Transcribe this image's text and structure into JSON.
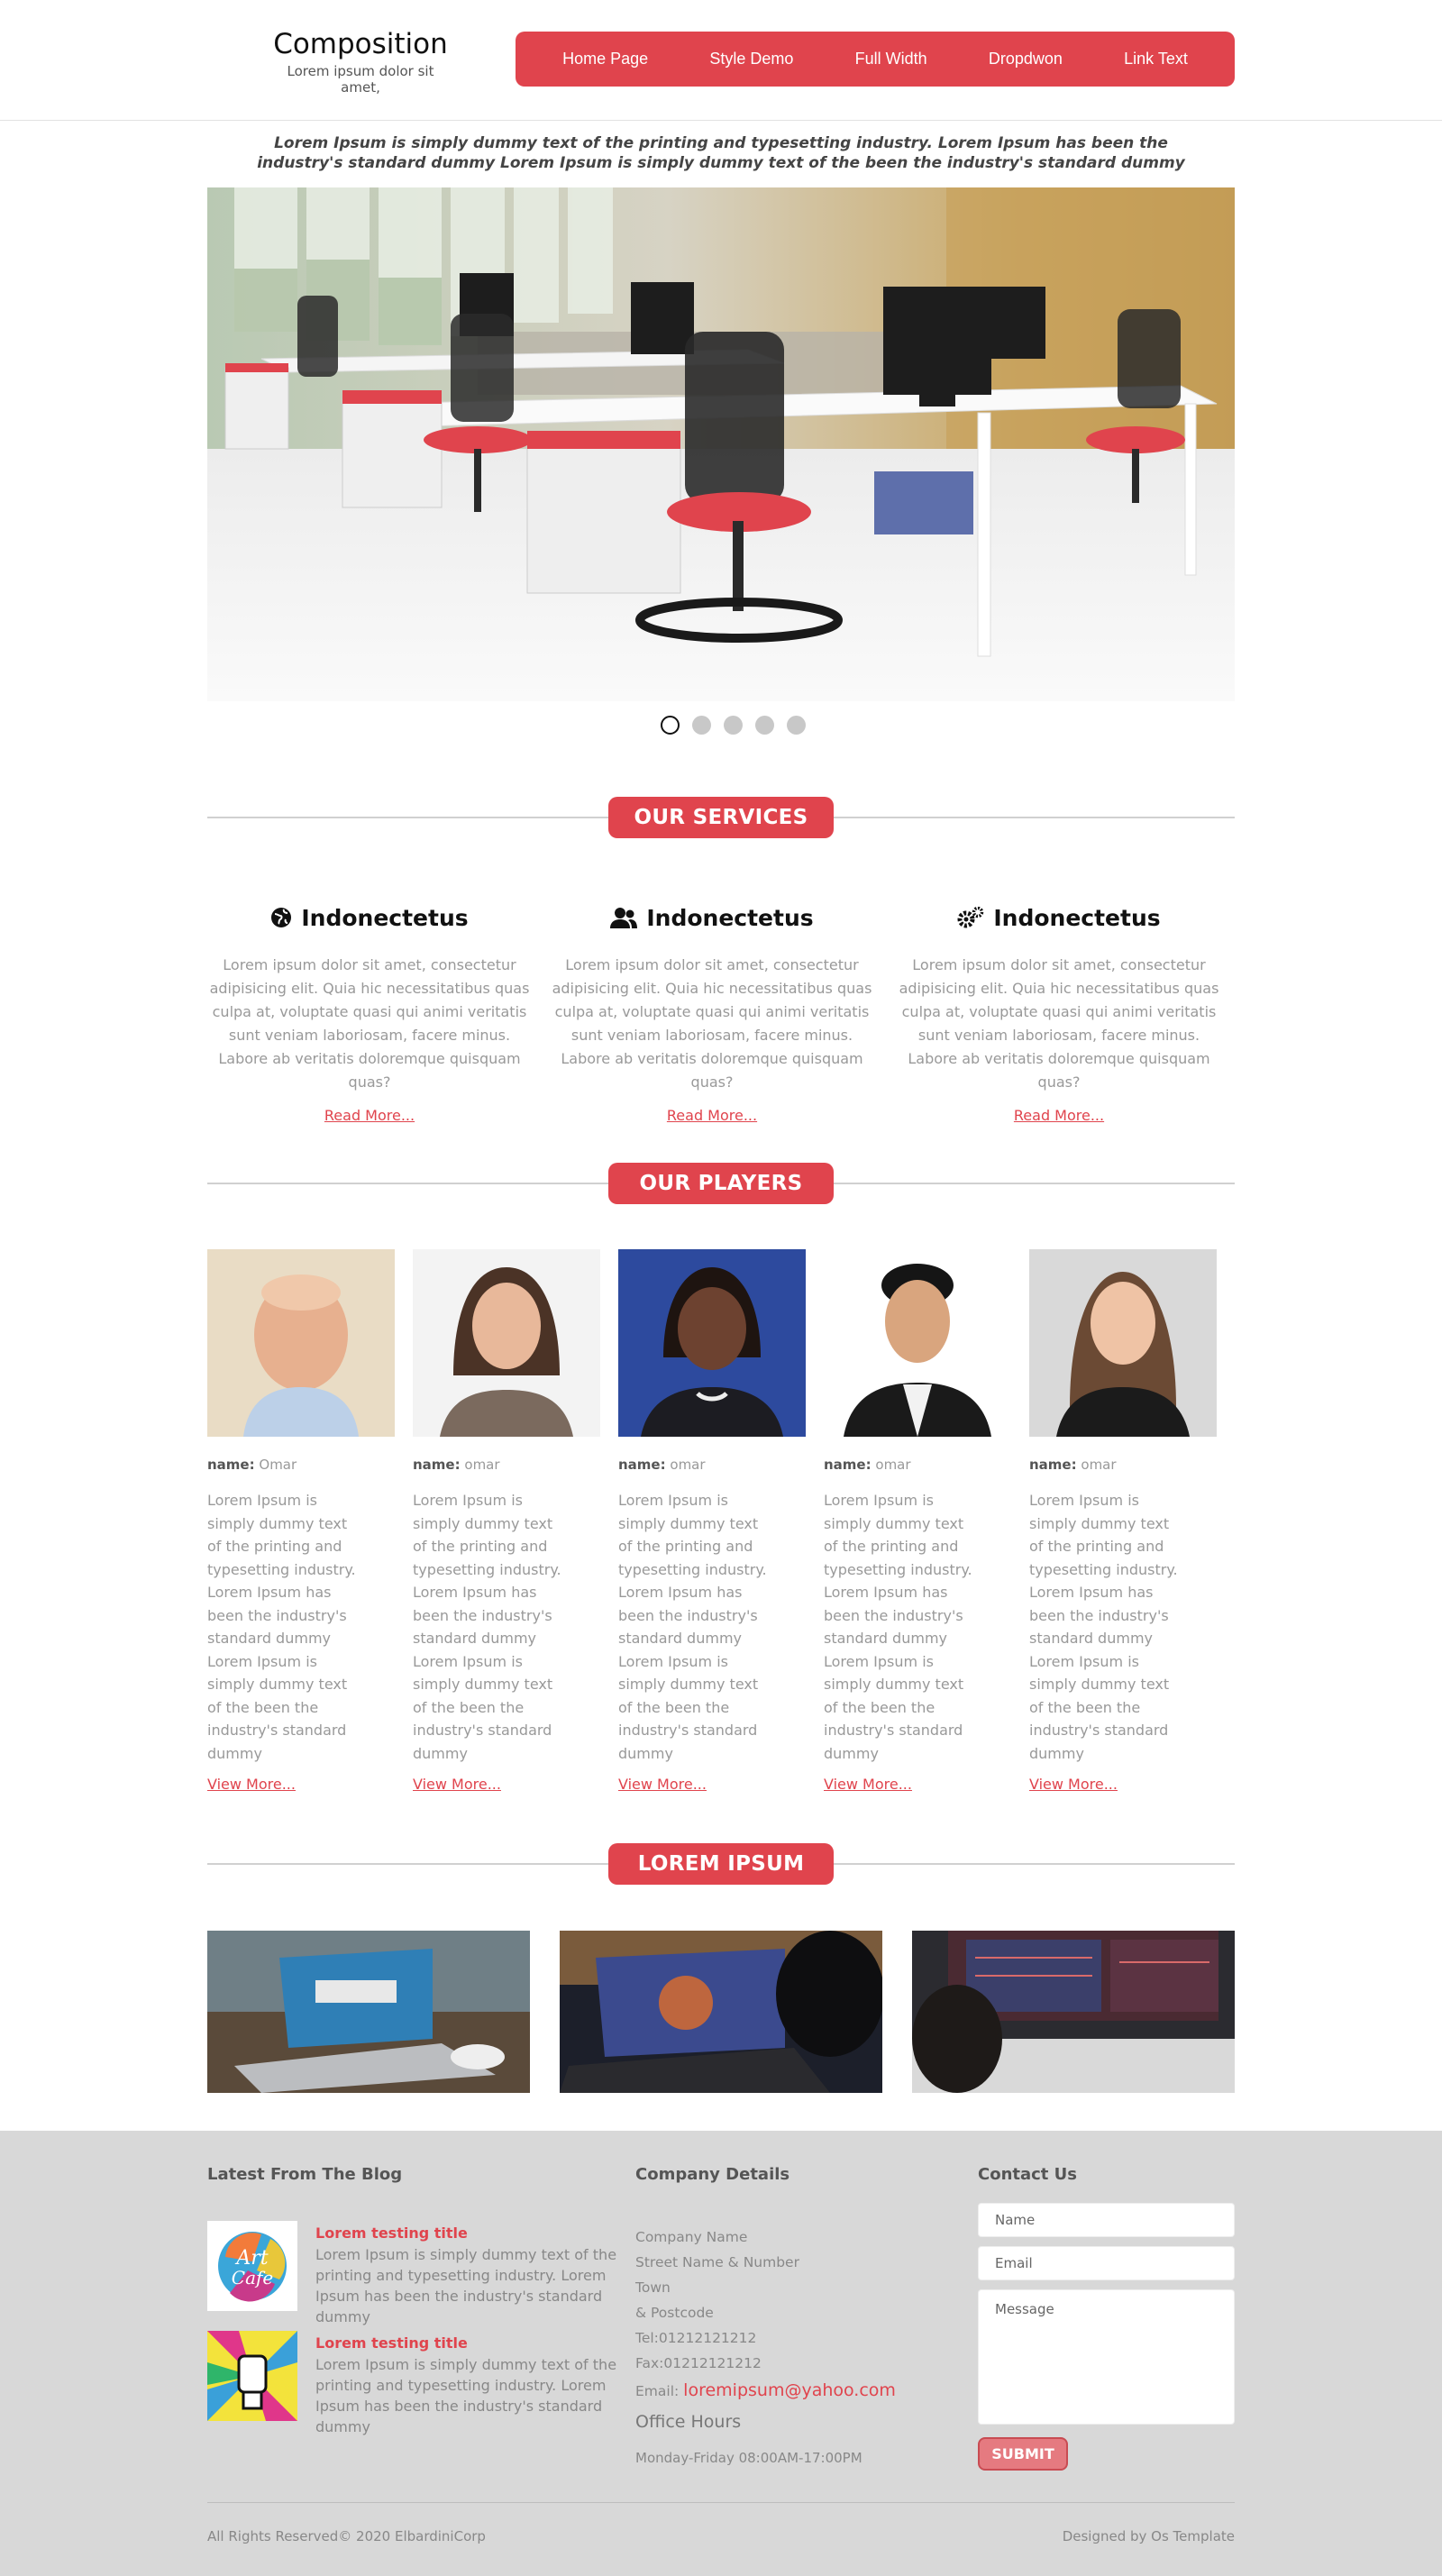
{
  "header": {
    "brand_title": "Composition",
    "brand_subtitle": "Lorem ipsum dolor sit amet,",
    "nav": [
      "Home Page",
      "Style Demo",
      "Full Width",
      "Dropdwon",
      "Link Text"
    ]
  },
  "intro": "Lorem Ipsum is simply dummy text of the printing and typesetting industry. Lorem Ipsum has been the industry's standard dummy Lorem Ipsum is simply dummy text of the been the industry's standard dummy",
  "slider": {
    "slide_count": 5,
    "active_index": 1
  },
  "services": {
    "heading": "OUR SERVICES",
    "items": [
      {
        "icon": "globe-icon",
        "title": "Indonectetus",
        "text": "Lorem ipsum dolor sit amet, consectetur adipisicing elit. Quia hic necessitatibus quas culpa at, voluptate quasi qui animi veritatis sunt veniam laboriosam, facere minus. Labore ab veritatis doloremque quisquam quas?",
        "link": "Read More..."
      },
      {
        "icon": "users-icon",
        "title": "Indonectetus",
        "text": "Lorem ipsum dolor sit amet, consectetur adipisicing elit. Quia hic necessitatibus quas culpa at, voluptate quasi qui animi veritatis sunt veniam laboriosam, facere minus. Labore ab veritatis doloremque quisquam quas?",
        "link": "Read More..."
      },
      {
        "icon": "gears-icon",
        "title": "Indonectetus",
        "text": "Lorem ipsum dolor sit amet, consectetur adipisicing elit. Quia hic necessitatibus quas culpa at, voluptate quasi qui animi veritatis sunt veniam laboriosam, facere minus. Labore ab veritatis doloremque quisquam quas?",
        "link": "Read More..."
      }
    ]
  },
  "players": {
    "heading": "OUR PLAYERS",
    "items": [
      {
        "label": "name:",
        "name": "Omar",
        "bio": "Lorem Ipsum is simply dummy text of the printing and typesetting industry. Lorem Ipsum has been the industry's standard dummy Lorem Ipsum is simply dummy text of the been the industry's standard dummy",
        "link": "View More..."
      },
      {
        "label": "name:",
        "name": "omar",
        "bio": "Lorem Ipsum is simply dummy text of the printing and typesetting industry. Lorem Ipsum has been the industry's standard dummy Lorem Ipsum is simply dummy text of the been the industry's standard dummy",
        "link": "View More..."
      },
      {
        "label": "name:",
        "name": "omar",
        "bio": "Lorem Ipsum is simply dummy text of the printing and typesetting industry. Lorem Ipsum has been the industry's standard dummy Lorem Ipsum is simply dummy text of the been the industry's standard dummy",
        "link": "View More..."
      },
      {
        "label": "name:",
        "name": "omar",
        "bio": "Lorem Ipsum is simply dummy text of the printing and typesetting industry. Lorem Ipsum has been the industry's standard dummy Lorem Ipsum is simply dummy text of the been the industry's standard dummy",
        "link": "View More..."
      },
      {
        "label": "name:",
        "name": "omar",
        "bio": "Lorem Ipsum is simply dummy text of the printing and typesetting industry. Lorem Ipsum has been the industry's standard dummy Lorem Ipsum is simply dummy text of the been the industry's standard dummy",
        "link": "View More..."
      }
    ]
  },
  "gallery": {
    "heading": "LOREM IPSUM"
  },
  "footer": {
    "blog": {
      "heading": "Latest From The Blog",
      "posts": [
        {
          "title": "Lorem testing title",
          "text": "Lorem Ipsum is simply dummy text of the printing and typesetting industry. Lorem Ipsum has been the industry's standard dummy"
        },
        {
          "title": "Lorem testing title",
          "text": "Lorem Ipsum is simply dummy text of the printing and typesetting industry. Lorem Ipsum has been the industry's standard dummy"
        }
      ]
    },
    "company": {
      "heading": "Company Details",
      "lines": [
        "Company Name",
        "Street Name & Number",
        "Town",
        "& Postcode",
        "Tel:01212121212",
        "Fax:01212121212"
      ],
      "email_label": "Email:",
      "email": "loremipsum@yahoo.com",
      "hours_title": "Office Hours",
      "hours": "Monday-Friday 08:00AM-17:00PM"
    },
    "contact": {
      "heading": "Contact Us",
      "name_placeholder": "Name",
      "email_placeholder": "Email",
      "message_placeholder": "Message",
      "submit": "SUBMIT"
    },
    "copyright": "All Rights Reserved© 2020 ElbardiniCorp",
    "designed_by": "Designed by Os Template"
  },
  "colors": {
    "accent": "#e0444d",
    "footer_bg": "#d8d8d8"
  }
}
